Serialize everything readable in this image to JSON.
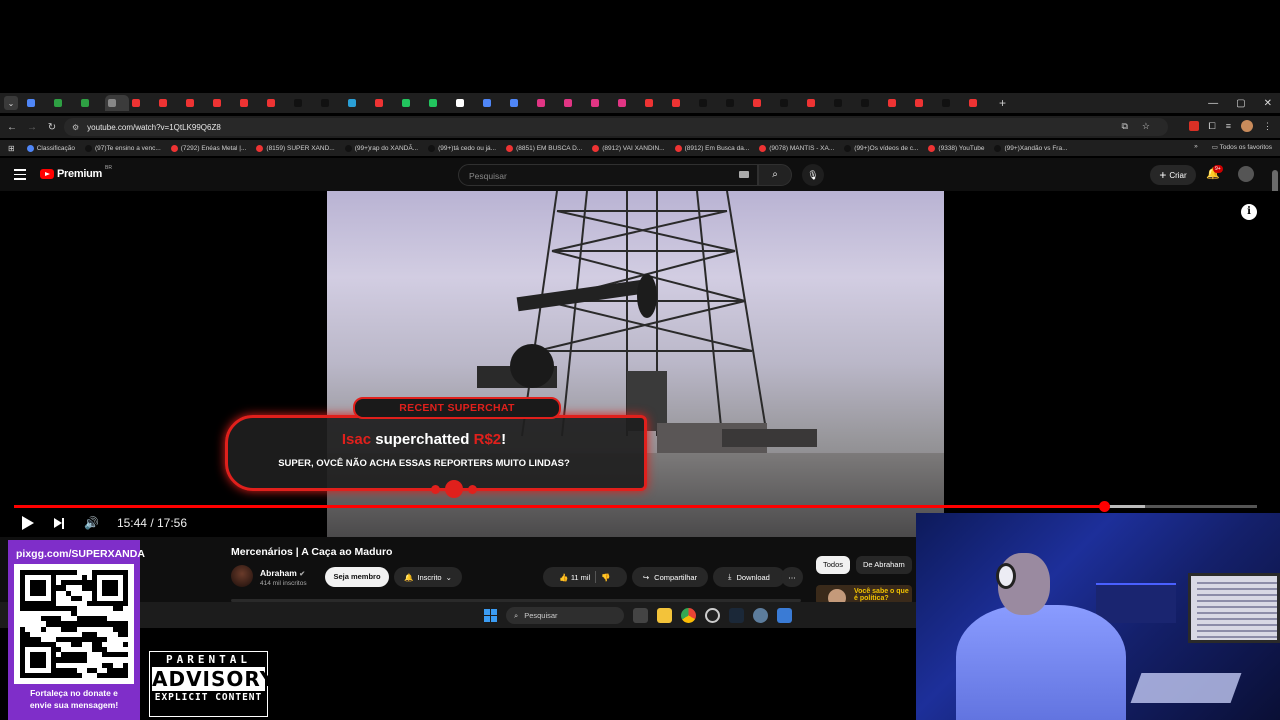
{
  "browser": {
    "tab_list_icon": "chevron-down-icon",
    "tab_favicons": [
      "#4f86f7",
      "#2ea043",
      "#2ea043",
      "#888",
      "#e33",
      "#e33",
      "#e33",
      "#e33",
      "#e33",
      "#e33",
      "#111",
      "#111",
      "#2a9fd6",
      "#e33",
      "#22c55e",
      "#22c55e",
      "#ffffff",
      "#4f86f7",
      "#4f86f7",
      "#e13584",
      "#e13584",
      "#e13584",
      "#e13584",
      "#e33",
      "#e33",
      "#111",
      "#111",
      "#e33",
      "#111",
      "#e33",
      "#111",
      "#111",
      "#e33",
      "#e33",
      "#111",
      "#e33"
    ],
    "window_controls": [
      "—",
      "▢",
      "✕"
    ],
    "url": "youtube.com/watch?v=1QtLK99Q6Z8",
    "bookmarks": [
      {
        "label": "Classificação",
        "color": "#4f86f7"
      },
      {
        "label": "(97)Te ensino a venc...",
        "color": "#111"
      },
      {
        "label": "(7292) Enéas Metal |...",
        "color": "#e33"
      },
      {
        "label": "(8159) SUPER XAND...",
        "color": "#e33"
      },
      {
        "label": "(99+)rap do XANDÃ...",
        "color": "#111"
      },
      {
        "label": "(99+)tá cedo ou já...",
        "color": "#111"
      },
      {
        "label": "(8851) EM BUSCA D...",
        "color": "#e33"
      },
      {
        "label": "(8912) VAI XANDIN...",
        "color": "#e33"
      },
      {
        "label": "(8912) Em Busca da...",
        "color": "#e33"
      },
      {
        "label": "(9078) MANTIS - XA...",
        "color": "#e33"
      },
      {
        "label": "(99+)Os vídeos de c...",
        "color": "#111"
      },
      {
        "label": "(9338) YouTube",
        "color": "#e33"
      },
      {
        "label": "(99+)Xandão vs Fra...",
        "color": "#111"
      }
    ],
    "all_bookmarks_label": "Todos os favoritos"
  },
  "youtube": {
    "logo_text": "Premium",
    "country_code": "BR",
    "search_placeholder": "Pesquisar",
    "create_label": "Criar",
    "notifications_badge": "9+",
    "player": {
      "current_time": "15:44",
      "duration": "17:56",
      "time_display": "15:44 / 17:56",
      "progress_fraction": 0.877,
      "buffer_fraction": 0.91
    },
    "superchat": {
      "tag": "RECENT SUPERCHAT",
      "name": "Isac",
      "verb": "superchatted",
      "amount": "R$2",
      "exclaim": "!",
      "message": "SUPER, OVCÊ NÃO ACHA ESSAS REPORTERS MUITO LINDAS?"
    },
    "video_title": "Mercenários | A Caça ao Maduro",
    "channel": {
      "name": "Abraham",
      "verified_icon": "verified-check-icon",
      "subscribers": "414 mil inscritos"
    },
    "member_button": "Seja membro",
    "subscribed_button": "Inscrito",
    "likes": "11 mil",
    "share_label": "Compartilhar",
    "download_label": "Download",
    "chips": [
      "Todos",
      "De Abraham"
    ],
    "side_thumb_text": "Você sabe o que é política?"
  },
  "taskbar": {
    "search_placeholder": "Pesquisar"
  },
  "overlay": {
    "pix_url": "pixgg.com/SUPERXANDA",
    "pix_caption_line1": "Fortaleça no donate e",
    "pix_caption_line2": "envie sua mensagem!",
    "advisory_top": "PARENTAL",
    "advisory_mid": "ADVISORY",
    "advisory_bot": "EXPLICIT CONTENT"
  },
  "colors": {
    "youtube_red": "#ff0000",
    "superchat_red": "#e0201c",
    "pix_purple": "#7f2ec9"
  }
}
